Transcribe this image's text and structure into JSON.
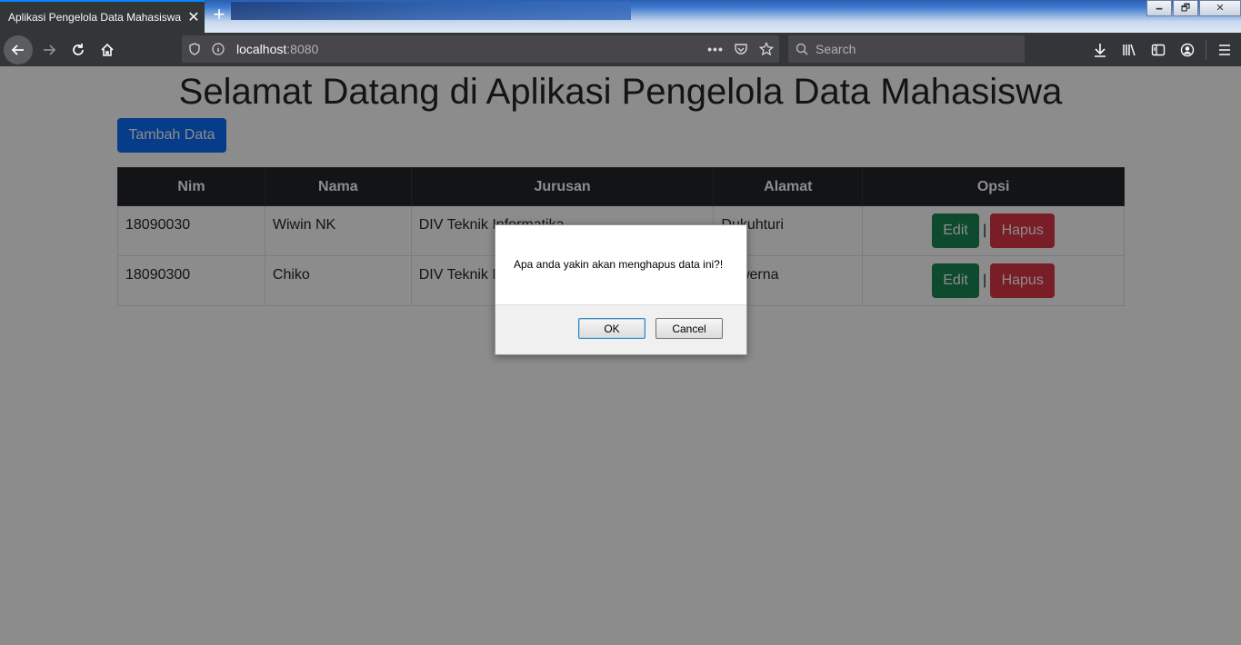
{
  "browser": {
    "tab_title": "Aplikasi Pengelola Data Mahasiswa",
    "tab_close": "✕",
    "new_tab": "+",
    "url_host": "localhost",
    "url_port": ":8080",
    "search_placeholder": "Search",
    "window_buttons": [
      "🗕",
      "🗗",
      "✕"
    ]
  },
  "page": {
    "title": "Selamat Datang di Aplikasi Pengelola Data Mahasiswa",
    "add_button": "Tambah Data",
    "table": {
      "headers": [
        "Nim",
        "Nama",
        "Jurusan",
        "Alamat",
        "Opsi"
      ],
      "rows": [
        {
          "nim": "18090030",
          "nama": "Wiwin NK",
          "jurusan": "DIV Teknik Informatika",
          "alamat": "Dukuhturi",
          "edit": "Edit",
          "hapus": "Hapus",
          "sep": "|"
        },
        {
          "nim": "18090300",
          "nama": "Chiko",
          "jurusan": "DIV Teknik Informatika",
          "alamat": "Suwerna",
          "edit": "Edit",
          "hapus": "Hapus",
          "sep": "|"
        }
      ]
    }
  },
  "dialog": {
    "message": "Apa anda yakin akan menghapus data ini?!",
    "ok": "OK",
    "cancel": "Cancel"
  },
  "colors": {
    "primary": "#0d6efd",
    "success": "#198754",
    "danger": "#dc3545",
    "table_header": "#212529"
  }
}
